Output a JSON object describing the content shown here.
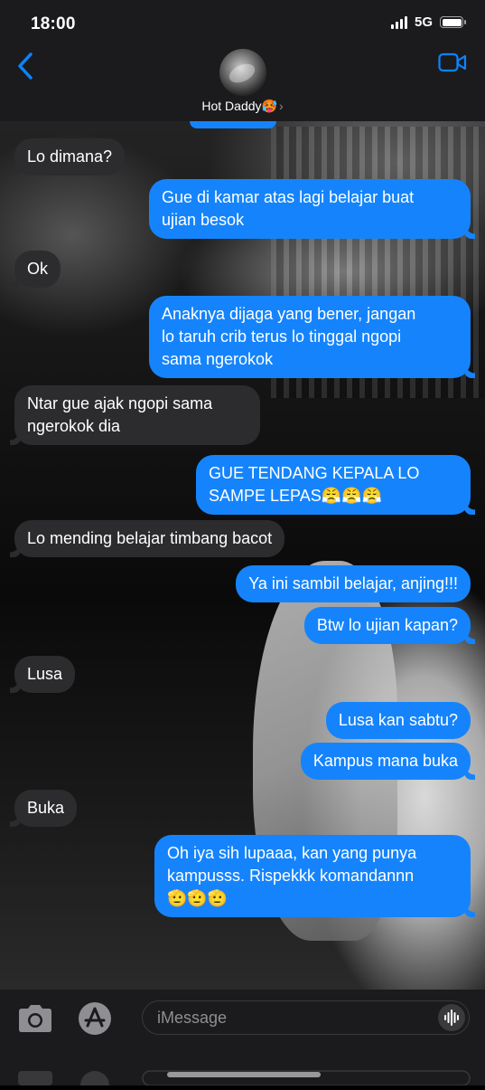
{
  "status_bar": {
    "time": "18:00",
    "network": "5G"
  },
  "header": {
    "contact_name": "Hot Daddy🥵",
    "chevron": "›"
  },
  "messages": [
    {
      "side": "in",
      "text": "Lo dimana?"
    },
    {
      "side": "out",
      "text": "Gue di kamar atas lagi belajar buat\nujian besok"
    },
    {
      "side": "in",
      "text": "Ok"
    },
    {
      "side": "out",
      "text": "Anaknya dijaga yang bener, jangan\nlo taruh crib terus lo tinggal ngopi\nsama ngerokok"
    },
    {
      "side": "in",
      "text": "Ntar gue ajak ngopi sama\nngerokok dia"
    },
    {
      "side": "out",
      "text": "GUE TENDANG KEPALA LO\nSAMPE LEPAS😤😤😤"
    },
    {
      "side": "in",
      "text": "Lo mending belajar timbang bacot"
    },
    {
      "side": "out",
      "text": "Ya ini sambil belajar, anjing!!!"
    },
    {
      "side": "out",
      "text": "Btw lo ujian kapan?"
    },
    {
      "side": "in",
      "text": "Lusa"
    },
    {
      "side": "out",
      "text": "Lusa kan sabtu?"
    },
    {
      "side": "out",
      "text": "Kampus mana buka"
    },
    {
      "side": "in",
      "text": "Buka"
    },
    {
      "side": "out",
      "text": "Oh iya sih lupaaa, kan yang punya\nkampusss. Rispekkk komandannn\n🫡🫡🫡"
    }
  ],
  "composer": {
    "placeholder": "iMessage"
  },
  "colors": {
    "outgoing": "#1584fc",
    "incoming": "#2c2c2e",
    "accent": "#0a84ff"
  },
  "icons": [
    "back-chevron-icon",
    "video-camera-icon",
    "camera-icon",
    "app-store-icon",
    "audio-waveform-icon"
  ]
}
